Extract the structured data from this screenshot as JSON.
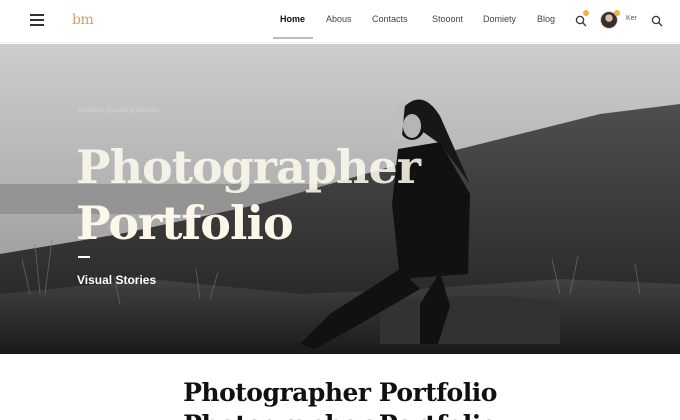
{
  "brand": {
    "logo_text": "bm",
    "logo_color": "#c7a66e"
  },
  "nav": {
    "links": [
      {
        "label": "Home",
        "active": true
      },
      {
        "label": "Abous",
        "active": false
      },
      {
        "label": "Contacts",
        "active": false
      },
      {
        "label": "Stooont",
        "active": false
      },
      {
        "label": "Domiety",
        "active": false
      },
      {
        "label": "Blog",
        "active": false
      }
    ],
    "user_name": "Ker",
    "icons": [
      "menu-icon",
      "search-icon",
      "avatar",
      "search-icon"
    ]
  },
  "hero": {
    "kicker": "Realities Quoatting Behiout",
    "title_line1": "Photographer",
    "title_line2": "Portfolio",
    "subtitle": "Visual Stories"
  },
  "section": {
    "title": "Photographer Portfolio",
    "title_line2": "Photographer Portfolio"
  },
  "colors": {
    "accent": "#f0b24a",
    "title_cream": "#fdf7e9"
  }
}
